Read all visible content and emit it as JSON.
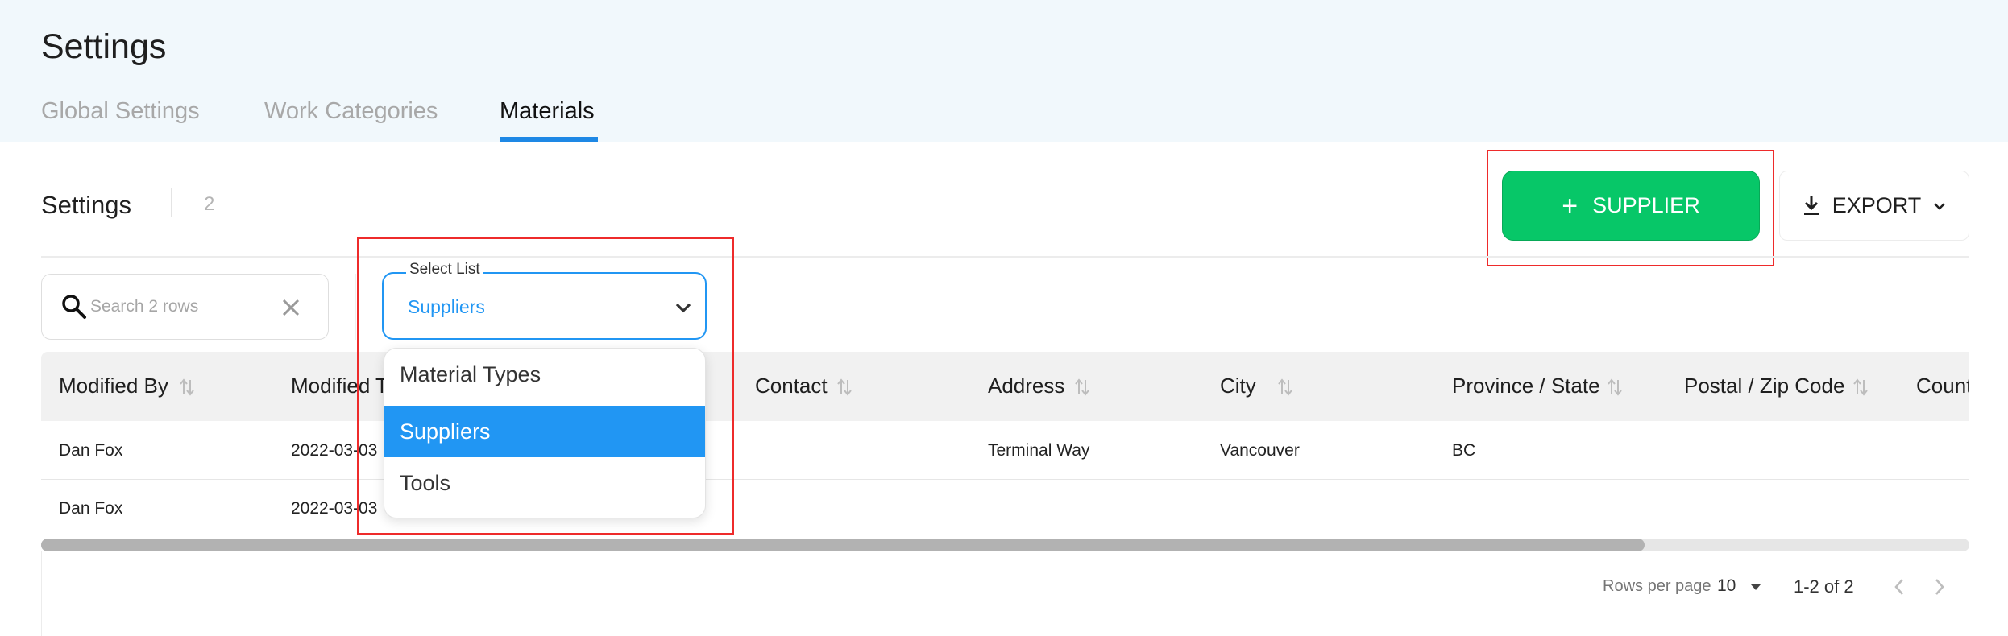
{
  "header": {
    "title": "Settings",
    "tabs": [
      {
        "label": "Global Settings"
      },
      {
        "label": "Work Categories"
      },
      {
        "label": "Materials"
      }
    ]
  },
  "section": {
    "title": "Settings",
    "count": "2"
  },
  "toolbar": {
    "add_label": "SUPPLIER",
    "export_label": "EXPORT"
  },
  "search": {
    "placeholder": "Search 2 rows"
  },
  "select_list": {
    "label": "Select List",
    "value": "Suppliers",
    "options": [
      "Material Types",
      "Suppliers",
      "Tools"
    ]
  },
  "table": {
    "columns": [
      "Modified By",
      "Modified T",
      "Contact",
      "Address",
      "City",
      "Province / State",
      "Postal / Zip Code",
      "Count"
    ],
    "rows": [
      {
        "modified_by": "Dan Fox",
        "modified_time": "2022-03-03",
        "address": "Terminal Way",
        "city": "Vancouver",
        "province": "BC"
      },
      {
        "modified_by": "Dan Fox",
        "modified_time": "2022-03-03"
      }
    ]
  },
  "pagination": {
    "rows_per_page_label": "Rows per page",
    "rows_per_page": "10",
    "range": "1-2 of 2"
  },
  "colors": {
    "accent_blue": "#2196f3",
    "add_green": "#07c768",
    "highlight_red": "#ee2b2b",
    "header_bg": "#f1f8fc"
  }
}
